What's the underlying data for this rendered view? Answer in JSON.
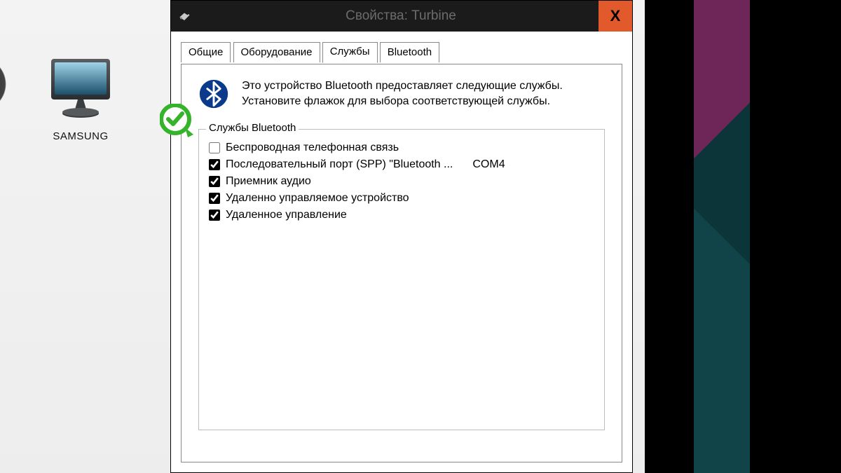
{
  "desktop": {
    "icon_label": "SAMSUNG"
  },
  "dialog": {
    "title": "Свойства: Turbine",
    "close_glyph": "X",
    "tabs": [
      "Общие",
      "Оборудование",
      "Службы",
      "Bluetooth"
    ],
    "active_tab_index": 2,
    "intro_line1": "Это устройство Bluetooth предоставляет следующие службы.",
    "intro_line2": "Установите флажок для выбора соответствующей службы.",
    "fieldset_legend": "Службы Bluetooth",
    "services": [
      {
        "checked": false,
        "label": "Беспроводная телефонная связь",
        "extra": ""
      },
      {
        "checked": true,
        "label": "Последовательный порт (SPP) \"Bluetooth ...",
        "extra": "COM4"
      },
      {
        "checked": true,
        "label": "Приемник аудио",
        "extra": ""
      },
      {
        "checked": true,
        "label": "Удаленно управляемое устройство",
        "extra": ""
      },
      {
        "checked": true,
        "label": "Удаленное управление",
        "extra": ""
      }
    ]
  }
}
